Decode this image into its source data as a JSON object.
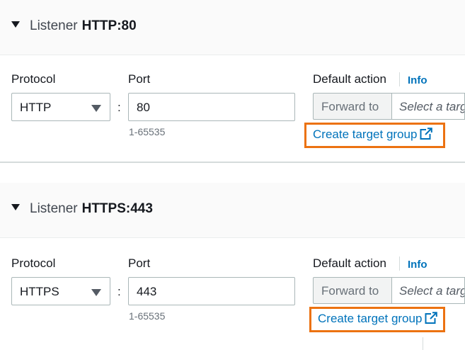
{
  "listeners": [
    {
      "header_prefix": "Listener",
      "header_name": "HTTP:80",
      "protocol_label": "Protocol",
      "protocol_value": "HTTP",
      "port_label": "Port",
      "port_value": "80",
      "port_hint": "1-65535",
      "default_action_label": "Default action",
      "info_label": "Info",
      "forward_label": "Forward to",
      "target_placeholder": "Select a targ",
      "create_link": "Create target group"
    },
    {
      "header_prefix": "Listener",
      "header_name": "HTTPS:443",
      "protocol_label": "Protocol",
      "protocol_value": "HTTPS",
      "port_label": "Port",
      "port_value": "443",
      "port_hint": "1-65535",
      "default_action_label": "Default action",
      "info_label": "Info",
      "forward_label": "Forward to",
      "target_placeholder": "Select a targ",
      "create_link": "Create target group"
    }
  ],
  "separator": ":",
  "colors": {
    "link": "#0073bb",
    "highlight": "#ec7211",
    "header_bg": "#fafafa"
  },
  "icons": {
    "expand": "caret-down-icon",
    "external": "external-link-icon",
    "select_arrow": "triangle-down-icon"
  }
}
